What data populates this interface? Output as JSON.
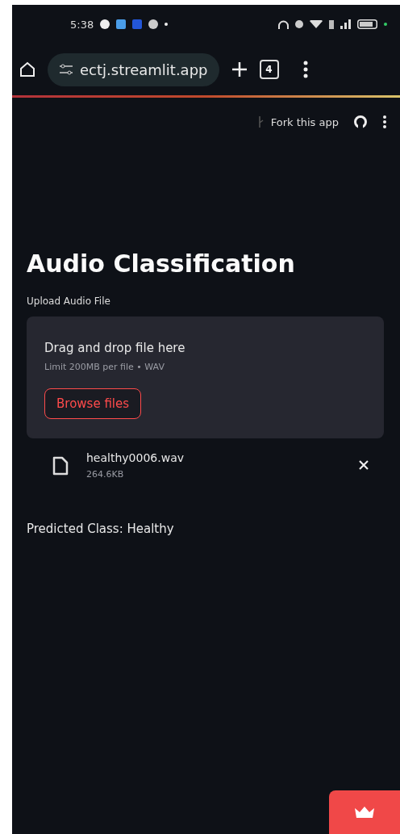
{
  "status_bar": {
    "time": "5:38"
  },
  "browser": {
    "url": "ectj.streamlit.app",
    "tab_count": "4"
  },
  "toolbar": {
    "fork_label": "Fork this app"
  },
  "title": "Audio Classification",
  "uploader": {
    "label": "Upload Audio File",
    "instructions": "Drag and drop file here",
    "limit": "Limit 200MB per file • WAV",
    "button": "Browse files"
  },
  "file": {
    "name": "healthy0006.wav",
    "size": "264.6KB"
  },
  "result": "Predicted Class: Healthy"
}
